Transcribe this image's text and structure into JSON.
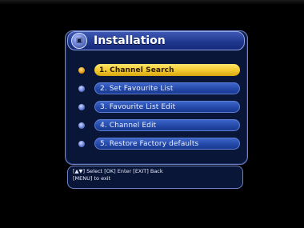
{
  "menu": {
    "title": "Installation",
    "title_icon": "settings-box-icon",
    "items": [
      {
        "label": "1. Channel Search",
        "selected": true
      },
      {
        "label": "2. Set Favourite List",
        "selected": false
      },
      {
        "label": "3. Favourite List Edit",
        "selected": false
      },
      {
        "label": "4. Channel Edit",
        "selected": false
      },
      {
        "label": "5. Restore Factory defaults",
        "selected": false
      }
    ]
  },
  "help": {
    "line1": "[▲▼] Select  [OK] Enter  [EXIT] Back",
    "line2": "[MENU] to exit"
  },
  "colors": {
    "accent": "#f2c92e",
    "panel": "#0a1638",
    "item": "#2247a7"
  }
}
